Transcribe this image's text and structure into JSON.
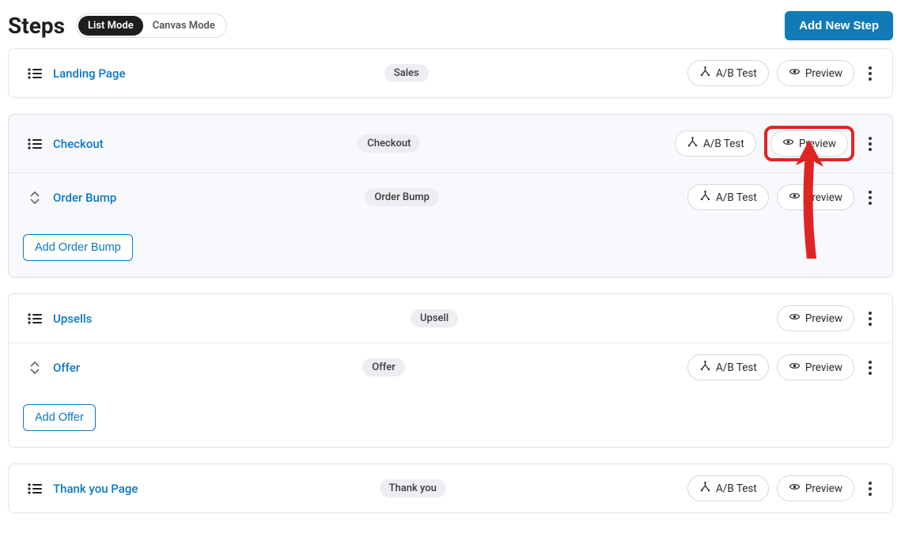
{
  "header": {
    "title": "Steps",
    "list_mode": "List Mode",
    "canvas_mode": "Canvas Mode",
    "add_step": "Add New Step"
  },
  "buttons": {
    "ab_test": "A/B Test",
    "preview": "Preview",
    "add_order_bump": "Add Order Bump",
    "add_offer": "Add Offer"
  },
  "rows": {
    "landing": {
      "name": "Landing Page",
      "badge": "Sales"
    },
    "checkout": {
      "name": "Checkout",
      "badge": "Checkout"
    },
    "order_bump": {
      "name": "Order Bump",
      "badge": "Order Bump"
    },
    "upsells": {
      "name": "Upsells",
      "badge": "Upsell"
    },
    "offer": {
      "name": "Offer",
      "badge": "Offer"
    },
    "thankyou": {
      "name": "Thank you Page",
      "badge": "Thank you"
    }
  }
}
